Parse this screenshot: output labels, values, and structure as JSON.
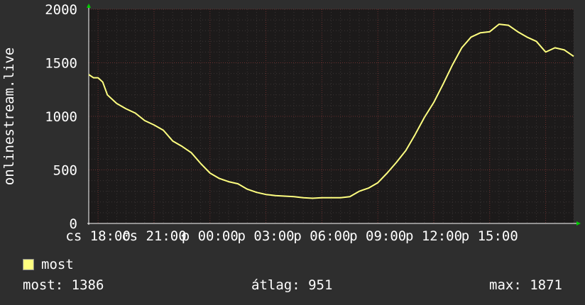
{
  "chart_data": {
    "type": "line",
    "ylabel": "onlinestream.live",
    "ylim": [
      0,
      2000
    ],
    "yticks": [
      0,
      500,
      1000,
      1500,
      2000
    ],
    "xticks": [
      "cs 18:00",
      "cs 21:00",
      "p 00:00",
      "p 03:00",
      "p 06:00",
      "p 09:00",
      "p 12:00",
      "p 15:00"
    ],
    "grid": true,
    "series": [
      {
        "name": "most",
        "color": "#ffff80",
        "x": [
          0,
          0.25,
          0.5,
          0.75,
          1,
          1.5,
          2,
          2.5,
          3,
          3.5,
          4,
          4.5,
          5,
          5.5,
          6,
          6.5,
          7,
          7.5,
          8,
          8.5,
          9,
          9.5,
          10,
          10.5,
          11,
          11.5,
          12,
          12.5,
          13,
          13.5,
          14,
          14.5,
          15,
          15.5,
          16,
          16.5,
          17,
          17.5,
          18,
          18.5,
          19,
          19.5,
          20,
          20.5,
          21,
          21.5,
          22,
          22.5,
          23,
          23.5,
          24,
          24.5,
          25,
          25.5,
          26
        ],
        "y": [
          1390,
          1360,
          1360,
          1320,
          1200,
          1120,
          1070,
          1030,
          960,
          920,
          870,
          770,
          720,
          660,
          560,
          470,
          420,
          390,
          370,
          320,
          290,
          270,
          260,
          255,
          250,
          240,
          235,
          240,
          240,
          240,
          250,
          300,
          330,
          380,
          470,
          570,
          680,
          830,
          990,
          1130,
          1300,
          1480,
          1640,
          1740,
          1780,
          1790,
          1860,
          1850,
          1790,
          1740,
          1700,
          1600,
          1640,
          1620,
          1560
        ]
      }
    ]
  },
  "legend": {
    "label": "most",
    "color": "#ffff80"
  },
  "stats": {
    "current": "most: 1386",
    "average": "átlag: 951",
    "max": "max: 1871"
  }
}
